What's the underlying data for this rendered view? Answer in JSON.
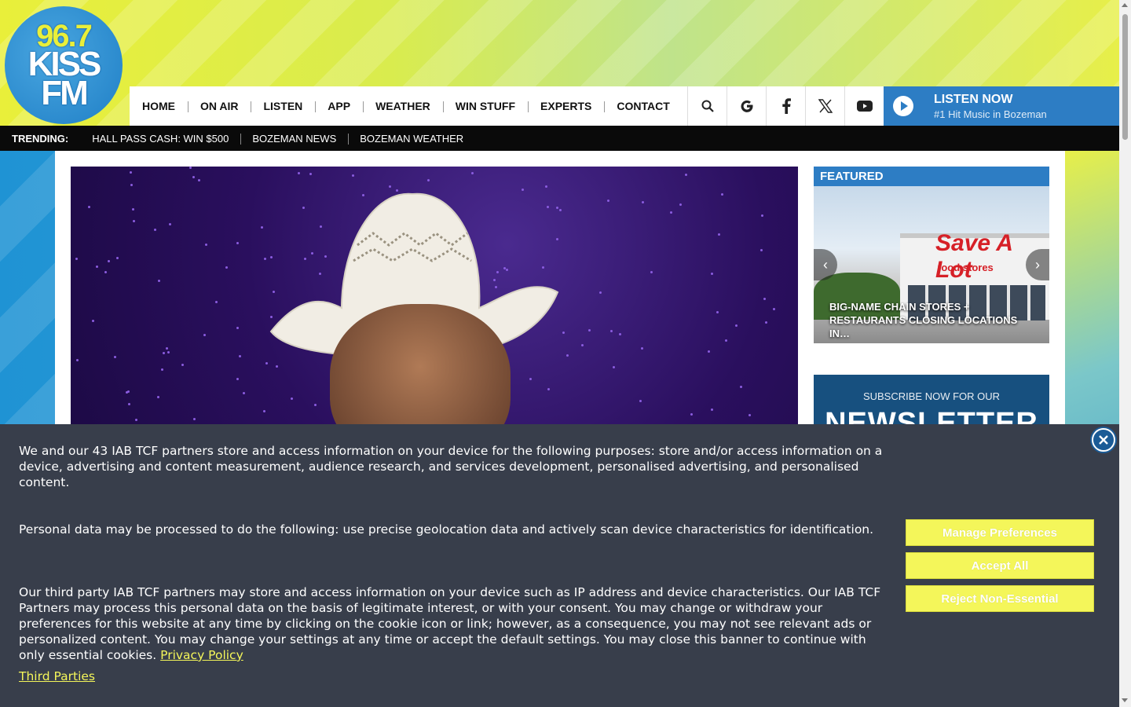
{
  "logo": {
    "line1": "96.7",
    "line2": "KISS",
    "line3": "FM"
  },
  "nav": {
    "items": [
      "HOME",
      "ON AIR",
      "LISTEN",
      "APP",
      "WEATHER",
      "WIN STUFF",
      "EXPERTS",
      "CONTACT"
    ],
    "icons": [
      "search-icon",
      "google-icon",
      "facebook-icon",
      "x-twitter-icon",
      "youtube-icon"
    ],
    "listen_now": {
      "title": "LISTEN NOW",
      "subtitle": "#1 Hit Music in Bozeman"
    }
  },
  "trending": {
    "label": "TRENDING:",
    "items": [
      "HALL PASS CASH: WIN $500",
      "BOZEMAN NEWS",
      "BOZEMAN WEATHER"
    ]
  },
  "sidebar": {
    "featured_label": "FEATURED",
    "featured_store_sign": "Save A Lot",
    "featured_store_sub": "food stores",
    "featured_caption": "BIG-NAME CHAIN STORES + RESTAURANTS CLOSING LOCATIONS IN…",
    "newsletter_sub": "SUBSCRIBE NOW FOR OUR",
    "newsletter_big": "NEWSLETTER"
  },
  "cookie": {
    "p1": "We and our 43 IAB TCF partners store and access information on your device for the following purposes: store and/or access information on a device, advertising and content measurement, audience research, and services development, personalised advertising, and personalised content.",
    "p2": "Personal data may be processed to do the following: use precise geolocation data and actively scan device characteristics for identification.",
    "p3": "Our third party IAB TCF partners may store and access information on your device such as IP address and device characteristics. Our IAB TCF Partners may process this personal data on the basis of legitimate interest, or with your consent. You may change or withdraw your preferences for this website at any time by clicking on the cookie icon or link; however, as a consequence, you may not see relevant ads or personalized content. You may change your settings at any time or accept the default settings. You may close this banner to continue with only essential cookies.",
    "privacy_link": "Privacy Policy",
    "third_parties": "Third Parties",
    "buttons": {
      "manage": "Manage Preferences",
      "accept": "Accept All",
      "reject": "Reject Non-Essential"
    }
  },
  "colors": {
    "brand_blue": "#2d7dc4",
    "accent_yellow": "#f4f65a",
    "banner_bg": "#383e4b"
  }
}
